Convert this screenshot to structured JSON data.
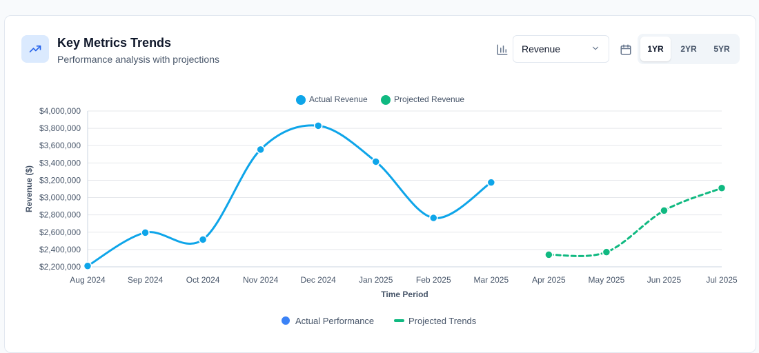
{
  "header": {
    "title": "Key Metrics Trends",
    "subtitle": "Performance analysis with projections",
    "icon": "trending-up-icon"
  },
  "controls": {
    "metric_icon": "bar-chart-icon",
    "metric_select": "Revenue",
    "calendar_icon": "calendar-icon",
    "ranges": [
      {
        "label": "1YR",
        "active": true
      },
      {
        "label": "2YR",
        "active": false
      },
      {
        "label": "5YR",
        "active": false
      }
    ]
  },
  "colors": {
    "actual": "#0ea5e9",
    "projected": "#10b981",
    "accent": "#3b82f6",
    "grid": "#e5e7eb"
  },
  "chart_data": {
    "type": "line",
    "categories": [
      "Aug 2024",
      "Sep 2024",
      "Oct 2024",
      "Nov 2024",
      "Dec 2024",
      "Jan 2025",
      "Feb 2025",
      "Mar 2025",
      "Apr 2025",
      "May 2025",
      "Jun 2025",
      "Jul 2025"
    ],
    "series": [
      {
        "name": "Actual Revenue",
        "values": [
          2210000,
          2595000,
          2515000,
          3555000,
          3830000,
          3415000,
          2765000,
          3175000,
          null,
          null,
          null,
          null
        ]
      },
      {
        "name": "Projected Revenue",
        "values": [
          null,
          null,
          null,
          null,
          null,
          null,
          null,
          null,
          2340000,
          2370000,
          2850000,
          3110000
        ]
      }
    ],
    "title": "",
    "xlabel": "Time Period",
    "ylabel": "Revenue ($)",
    "ylim": [
      2200000,
      4000000
    ],
    "yticks": [
      "$2,200,000",
      "$2,400,000",
      "$2,600,000",
      "$2,800,000",
      "$3,000,000",
      "$3,200,000",
      "$3,400,000",
      "$3,600,000",
      "$3,800,000",
      "$4,000,000"
    ],
    "grid": true,
    "legend_top": [
      "Actual Revenue",
      "Projected Revenue"
    ],
    "legend_bottom": [
      "Actual Performance",
      "Projected Trends"
    ]
  }
}
